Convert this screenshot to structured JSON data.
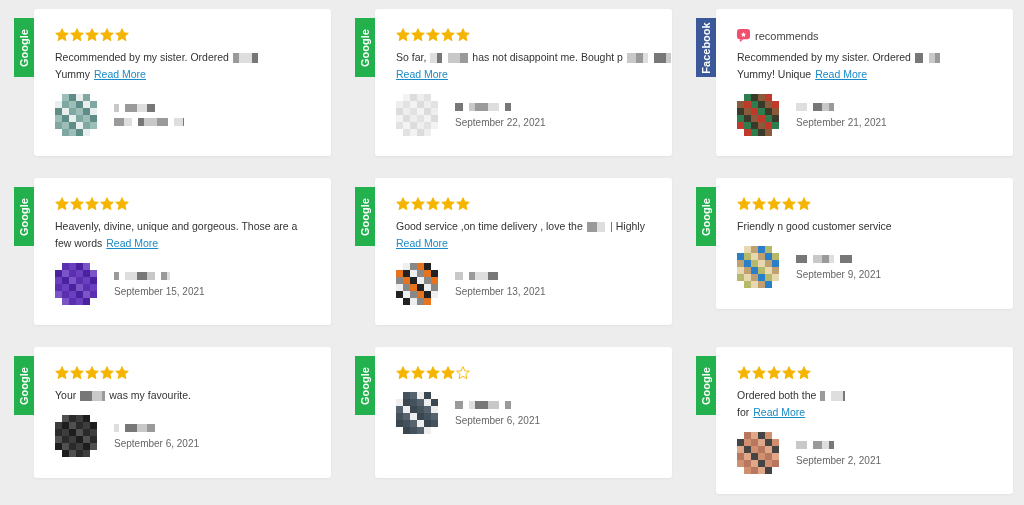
{
  "reviews": [
    {
      "source": "Google",
      "color": "#22b14c",
      "kind": "stars",
      "stars": 5,
      "lines": [
        [
          {
            "kind": "text",
            "text": "Recommended by my sister. Ordered"
          },
          {
            "kind": "redacted"
          }
        ],
        [
          {
            "kind": "text",
            "text": "Yummy"
          },
          {
            "kind": "link",
            "text": "Read More"
          }
        ]
      ],
      "avatar": {
        "kind": "picture"
      }
    },
    {
      "source": "Google",
      "color": "#22b14c",
      "kind": "stars",
      "stars": 5,
      "lines": [
        [
          {
            "kind": "text",
            "text": "So far,"
          },
          {
            "kind": "redacted"
          },
          {
            "kind": "text",
            "text": "has not disappoint me. Bought p"
          },
          {
            "kind": "redacted"
          }
        ],
        [
          {
            "kind": "link",
            "text": "Read More"
          }
        ]
      ],
      "avatar": {
        "kind": "picture"
      },
      "date": "September 22, 2021"
    },
    {
      "source": "Facebook",
      "color": "#3b5998",
      "kind": "recommendation",
      "label": "recommends",
      "lines": [
        [
          {
            "kind": "text",
            "text": "Recommended by my sister. Ordered"
          },
          {
            "kind": "redacted"
          }
        ],
        [
          {
            "kind": "text",
            "text": "Yummy! Unique"
          },
          {
            "kind": "link",
            "text": "Read More"
          }
        ]
      ],
      "avatar": {
        "kind": "picture"
      },
      "date": "September 21, 2021"
    },
    {
      "source": "Google",
      "color": "#22b14c",
      "kind": "stars",
      "stars": 5,
      "lines": [
        [
          {
            "kind": "text",
            "text": "Heavenly, divine, unique and gorgeous. Those are a"
          }
        ],
        [
          {
            "kind": "text",
            "text": "few words"
          },
          {
            "kind": "link",
            "text": "Read More"
          }
        ]
      ],
      "avatar": {
        "kind": "picture"
      },
      "date": "September 15, 2021"
    },
    {
      "source": "Google",
      "color": "#22b14c",
      "kind": "stars",
      "stars": 5,
      "lines": [
        [
          {
            "kind": "text",
            "text": "Good service ,on time delivery , love the"
          },
          {
            "kind": "redacted"
          },
          {
            "kind": "text",
            "text": "Highly"
          }
        ],
        [
          {
            "kind": "link",
            "text": "Read More"
          }
        ]
      ],
      "avatar": {
        "kind": "picture"
      },
      "date": "September 13, 2021"
    },
    {
      "source": "Google",
      "color": "#22b14c",
      "kind": "stars",
      "stars": 5,
      "lines": [
        [
          {
            "kind": "text",
            "text": "Friendly n good customer service"
          }
        ]
      ],
      "avatar": {
        "kind": "picture"
      },
      "date": "September 9, 2021"
    },
    {
      "source": "Google",
      "color": "#22b14c",
      "kind": "stars",
      "stars": 5,
      "lines": [
        [
          {
            "kind": "text",
            "text": "Your"
          },
          {
            "kind": "redacted"
          },
          {
            "kind": "text",
            "text": "was my favourite."
          }
        ]
      ],
      "avatar": {
        "kind": "picture"
      },
      "date": "September 6, 2021"
    },
    {
      "source": "Google",
      "color": "#22b14c",
      "kind": "stars",
      "stars": 4,
      "avatar": {
        "kind": "picture"
      },
      "date": "September 6, 2021"
    },
    {
      "source": "Google",
      "color": "#22b14c",
      "kind": "stars",
      "stars": 5,
      "lines": [
        [
          {
            "kind": "text",
            "text": "Ordered both the"
          },
          {
            "kind": "redacted"
          }
        ],
        [
          {
            "kind": "text",
            "text": "for"
          },
          {
            "kind": "link",
            "text": "Read More"
          }
        ]
      ],
      "avatar": {
        "kind": "picture"
      },
      "date": "September 2, 2021"
    }
  ]
}
